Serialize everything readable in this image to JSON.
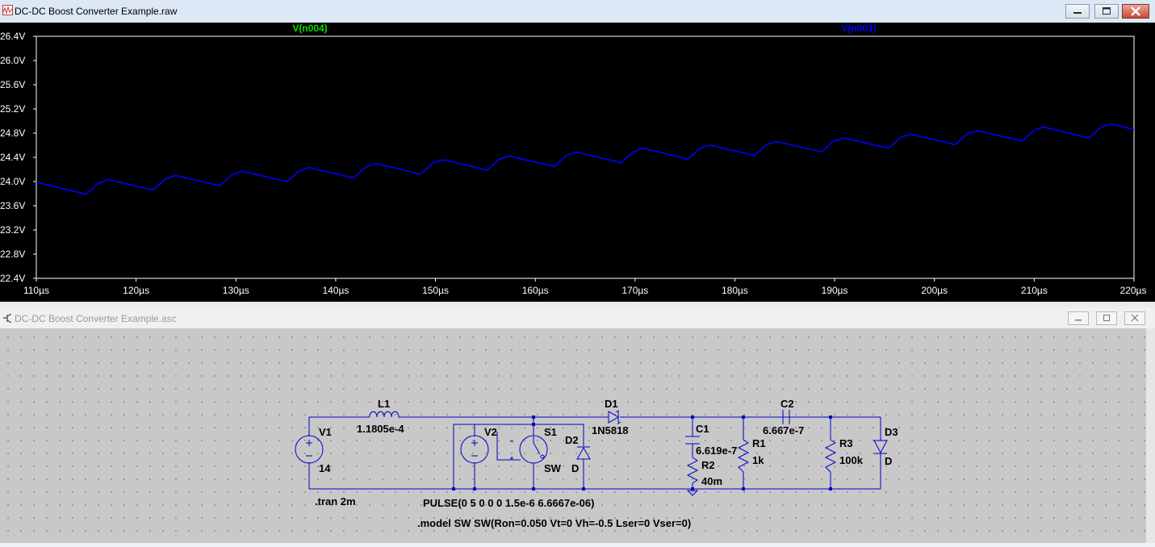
{
  "plot_window": {
    "title": "DC-DC Boost Converter Example.raw",
    "traces": [
      {
        "name": "V(n004)",
        "color": "#00e000"
      },
      {
        "name": "V(n003)",
        "color": "#0000ff"
      }
    ]
  },
  "schematic_window": {
    "title": "DC-DC Boost Converter Example.asc",
    "components": {
      "v1": {
        "name": "V1",
        "value": "14"
      },
      "l1": {
        "name": "L1",
        "value": "1.1805e-4"
      },
      "v2": {
        "name": "V2"
      },
      "s1": {
        "name": "S1",
        "model": "SW"
      },
      "d2": {
        "name": "D2",
        "model": "D"
      },
      "d1": {
        "name": "D1",
        "model": "1N5818"
      },
      "c1": {
        "name": "C1",
        "value": "6.619e-7"
      },
      "r2": {
        "name": "R2",
        "value": "40m"
      },
      "r1": {
        "name": "R1",
        "value": "1k"
      },
      "c2": {
        "name": "C2",
        "value": "6.667e-7"
      },
      "r3": {
        "name": "R3",
        "value": "100k"
      },
      "d3": {
        "name": "D3",
        "model": "D"
      }
    },
    "directives": {
      "tran": ".tran 2m",
      "pulse": "PULSE(0 5 0 0 0 1.5e-6 6.6667e-06)",
      "model": ".model SW SW(Ron=0.050 Vt=0 Vh=-0.5 Lser=0 Vser=0)"
    }
  },
  "chart_data": {
    "type": "line",
    "x_unit": "µs",
    "xlim": [
      110,
      220
    ],
    "ylim": [
      22.4,
      26.4
    ],
    "x_ticks": [
      "110µs",
      "120µs",
      "130µs",
      "140µs",
      "150µs",
      "160µs",
      "170µs",
      "180µs",
      "190µs",
      "200µs",
      "210µs",
      "220µs"
    ],
    "y_ticks": [
      "26.4V",
      "26.0V",
      "25.6V",
      "25.2V",
      "24.8V",
      "24.4V",
      "24.0V",
      "23.6V",
      "23.2V",
      "22.8V",
      "22.4V"
    ],
    "series": [
      {
        "name": "V(n003)",
        "color": "#0000ff",
        "x": [
          110,
          115,
          116.2,
          117.2,
          121.7,
          122.9,
          123.9,
          128.4,
          129.6,
          130.6,
          135.1,
          136.3,
          137.3,
          141.8,
          143.0,
          144.0,
          148.5,
          149.7,
          150.7,
          155.2,
          156.4,
          157.4,
          161.9,
          163.1,
          164.1,
          168.6,
          169.8,
          170.8,
          175.3,
          176.5,
          177.5,
          182.0,
          183.2,
          184.2,
          188.7,
          189.9,
          190.9,
          195.4,
          196.6,
          197.6,
          202.1,
          203.3,
          204.3,
          208.8,
          210.0,
          211.0,
          215.5,
          216.7,
          217.7,
          220
        ],
        "y": [
          23.99,
          23.79,
          23.97,
          24.03,
          23.86,
          24.04,
          24.1,
          23.93,
          24.11,
          24.17,
          24.0,
          24.17,
          24.23,
          24.06,
          24.24,
          24.3,
          24.12,
          24.3,
          24.36,
          24.19,
          24.37,
          24.42,
          24.25,
          24.43,
          24.49,
          24.31,
          24.49,
          24.55,
          24.37,
          24.55,
          24.6,
          24.43,
          24.61,
          24.66,
          24.49,
          24.67,
          24.72,
          24.55,
          24.73,
          24.78,
          24.61,
          24.79,
          24.84,
          24.67,
          24.85,
          24.9,
          24.72,
          24.9,
          24.95,
          24.86
        ]
      }
    ]
  }
}
